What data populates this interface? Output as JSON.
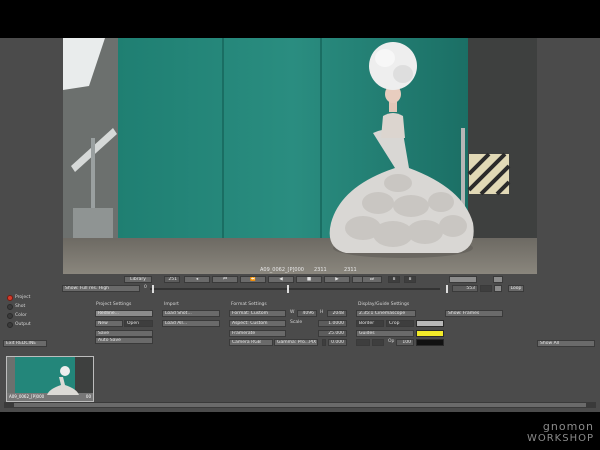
{
  "viewer_overlay": {
    "shot_name": "A09_0062_[P]000",
    "frame_a": "2311",
    "frame_b": "2311"
  },
  "transport": {
    "library_label": "Library",
    "frame_field": "251",
    "btn_play_back": "◂",
    "btn_start": "⏮",
    "btn_prev": "⏪",
    "btn_step_back": "◀",
    "btn_stop": "■",
    "btn_step_fwd": "▶",
    "btn_next": "⏩",
    "btn_end": "⏭",
    "btn_a": "8",
    "btn_b": "8"
  },
  "timeline": {
    "show_label": "Show: Full res. High",
    "start_frame": "0",
    "end_frame": "553",
    "loop_label": "Loop"
  },
  "views": {
    "project": "Project",
    "shot": "Shot",
    "color": "Color",
    "output": "Output",
    "selected": "project"
  },
  "exit_label": "Exit REDCINE",
  "project_settings": {
    "title": "Project Settings",
    "btn1": "Redline...",
    "btn2": "New",
    "btn3": "Open",
    "btn4": "Save",
    "btn5": "Auto Save"
  },
  "import": {
    "title": "Import",
    "btn1": "Load Shot...",
    "btn2": "Load All..."
  },
  "format_settings": {
    "title": "Format Settings",
    "format": "Format: Custom",
    "w_label": "W",
    "w_value": "4096",
    "h_label": "H",
    "h_value": "2048",
    "aspect": "Aspect: Custom",
    "scale_label": "Scale",
    "scale_value": "1.0000",
    "framerate": "Framerate",
    "framerate_value": "25.000",
    "camera": "Camera RGB",
    "gamma": "Gamma: Pro...PIX",
    "extra_value": "0.000"
  },
  "display_guide": {
    "title": "Display/Guide Settings",
    "ratio": "2.35:1 Cinemascope",
    "show_frames": "Show: Frames",
    "border_label": "Border",
    "crop_label": "Crop",
    "guides_label": "Guides",
    "op_label": "Op",
    "op_value": "100",
    "border_color": "#b8b8b8",
    "guide_color": "#f2ea2a"
  },
  "show_all_label": "Show All",
  "thumbnail": {
    "label": "A09_0062_[P]000",
    "badge": "00"
  },
  "logo": {
    "line1": "gnomon",
    "line2": "WORKSHOP"
  }
}
